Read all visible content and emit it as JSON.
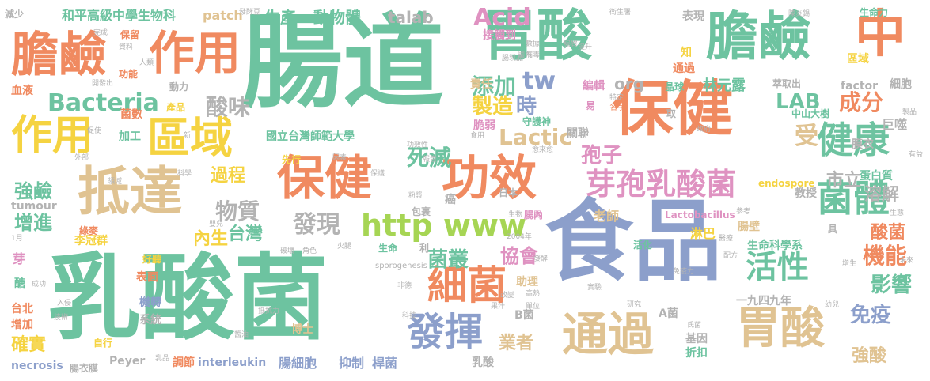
{
  "palette": {
    "green": "#6dc3a0",
    "orange": "#f08a60",
    "blue": "#8c9fcb",
    "pink": "#df92c1",
    "lime": "#a6d554",
    "yellow": "#f5d341",
    "tan": "#e0c392",
    "gray": "#b3b3b3"
  },
  "words": [
    {
      "text": "腸道",
      "size": 128,
      "color": "green"
    },
    {
      "text": "乳酸菌",
      "size": 118,
      "color": "green"
    },
    {
      "text": "食品",
      "size": 112,
      "color": "blue"
    },
    {
      "text": "胃酸",
      "size": 70,
      "color": "green"
    },
    {
      "text": "膽鹼",
      "size": 66,
      "color": "green"
    },
    {
      "text": "保健",
      "size": 76,
      "color": "orange"
    },
    {
      "text": "中",
      "size": 64,
      "color": "orange"
    },
    {
      "text": "膽鹼",
      "size": 60,
      "color": "orange"
    },
    {
      "text": "作用",
      "size": 58,
      "color": "orange"
    },
    {
      "text": "作用",
      "size": 52,
      "color": "yellow"
    },
    {
      "text": "區域",
      "size": 54,
      "color": "yellow"
    },
    {
      "text": "抵達",
      "size": 66,
      "color": "tan"
    },
    {
      "text": "保健",
      "size": 60,
      "color": "orange"
    },
    {
      "text": "功效",
      "size": 60,
      "color": "orange"
    },
    {
      "text": "通過",
      "size": 58,
      "color": "tan"
    },
    {
      "text": "胃酸",
      "size": 56,
      "color": "tan"
    },
    {
      "text": "細菌",
      "size": 50,
      "color": "orange"
    },
    {
      "text": "發揮",
      "size": 48,
      "color": "blue"
    },
    {
      "text": "健康",
      "size": 46,
      "color": "green"
    },
    {
      "text": "菌體",
      "size": 46,
      "color": "green"
    },
    {
      "text": "活性",
      "size": 40,
      "color": "green"
    },
    {
      "text": "芽孢乳酸菌",
      "size": 38,
      "color": "pink"
    },
    {
      "text": "http www",
      "size": 38,
      "color": "lime"
    },
    {
      "text": "Bacteria",
      "size": 30,
      "color": "green"
    },
    {
      "text": "Acid",
      "size": 30,
      "color": "pink"
    },
    {
      "text": "tw",
      "size": 30,
      "color": "blue"
    },
    {
      "text": "Lactic",
      "size": 28,
      "color": "tan"
    },
    {
      "text": "LAB",
      "size": 26,
      "color": "green"
    },
    {
      "text": "成分",
      "size": 28,
      "color": "orange"
    },
    {
      "text": "發現",
      "size": 30,
      "color": "gray"
    },
    {
      "text": "物質",
      "size": 28,
      "color": "gray"
    },
    {
      "text": "酸味",
      "size": 28,
      "color": "gray"
    },
    {
      "text": "添加",
      "size": 28,
      "color": "green"
    },
    {
      "text": "製造",
      "size": 26,
      "color": "yellow"
    },
    {
      "text": "時",
      "size": 26,
      "color": "blue"
    },
    {
      "text": "死滅",
      "size": 28,
      "color": "green"
    },
    {
      "text": "孢子",
      "size": 26,
      "color": "pink"
    },
    {
      "text": "菌叢",
      "size": 26,
      "color": "green"
    },
    {
      "text": "協會",
      "size": 24,
      "color": "pink"
    },
    {
      "text": "機能",
      "size": 28,
      "color": "orange"
    },
    {
      "text": "影響",
      "size": 26,
      "color": "green"
    },
    {
      "text": "免疫",
      "size": 26,
      "color": "blue"
    },
    {
      "text": "強酸",
      "size": 22,
      "color": "tan"
    },
    {
      "text": "業者",
      "size": 22,
      "color": "tan"
    },
    {
      "text": "酸菌",
      "size": 22,
      "color": "orange"
    },
    {
      "text": "受",
      "size": 30,
      "color": "tan"
    },
    {
      "text": "溶解",
      "size": 22,
      "color": "gray"
    },
    {
      "text": "市立",
      "size": 22,
      "color": "gray"
    },
    {
      "text": "強鹼",
      "size": 24,
      "color": "green"
    },
    {
      "text": "過程",
      "size": 22,
      "color": "yellow"
    },
    {
      "text": "增進",
      "size": 24,
      "color": "green"
    },
    {
      "text": "台灣",
      "size": 22,
      "color": "green"
    },
    {
      "text": "內生",
      "size": 22,
      "color": "yellow"
    },
    {
      "text": "確實",
      "size": 22,
      "color": "yellow"
    },
    {
      "text": "生產",
      "size": 20,
      "color": "green"
    },
    {
      "text": "動物體",
      "size": 20,
      "color": "green"
    },
    {
      "text": "talab",
      "size": 20,
      "color": "gray"
    },
    {
      "text": "org",
      "size": 20,
      "color": "gray"
    },
    {
      "text": "林元露",
      "size": 18,
      "color": "green"
    },
    {
      "text": "國立台灣師範大學",
      "size": 14,
      "color": "green"
    },
    {
      "text": "生命科學系",
      "size": 14,
      "color": "green"
    },
    {
      "text": "和平高級中學生物科",
      "size": 16,
      "color": "green"
    },
    {
      "text": "patch",
      "size": 16,
      "color": "tan"
    },
    {
      "text": "李冠群",
      "size": 14,
      "color": "yellow"
    },
    {
      "text": "老師",
      "size": 16,
      "color": "tan"
    },
    {
      "text": "教授",
      "size": 14,
      "color": "gray"
    },
    {
      "text": "助理",
      "size": 14,
      "color": "tan"
    },
    {
      "text": "博士",
      "size": 14,
      "color": "tan"
    },
    {
      "text": "淋巴",
      "size": 16,
      "color": "yellow"
    },
    {
      "text": "腸壁",
      "size": 14,
      "color": "tan"
    },
    {
      "text": "蛋白質",
      "size": 14,
      "color": "green"
    },
    {
      "text": "巨噬",
      "size": 16,
      "color": "gray"
    },
    {
      "text": "膜衣",
      "size": 14,
      "color": "gray"
    },
    {
      "text": "細胞",
      "size": 14,
      "color": "gray"
    },
    {
      "text": "factor",
      "size": 14,
      "color": "gray"
    },
    {
      "text": "endospore",
      "size": 12,
      "color": "yellow"
    },
    {
      "text": "Lactobacillus",
      "size": 12,
      "color": "pink"
    },
    {
      "text": "interleukin",
      "size": 14,
      "color": "blue"
    },
    {
      "text": "necrosis",
      "size": 14,
      "color": "blue"
    },
    {
      "text": "tumour",
      "size": 14,
      "color": "gray"
    },
    {
      "text": "Peyer",
      "size": 14,
      "color": "gray"
    },
    {
      "text": "腸細胞",
      "size": 16,
      "color": "blue"
    },
    {
      "text": "抑制",
      "size": 16,
      "color": "blue"
    },
    {
      "text": "桿菌",
      "size": 16,
      "color": "blue"
    },
    {
      "text": "乳酸",
      "size": 14,
      "color": "gray"
    },
    {
      "text": "折扣",
      "size": 14,
      "color": "green"
    },
    {
      "text": "基因",
      "size": 14,
      "color": "gray"
    },
    {
      "text": "A菌",
      "size": 14,
      "color": "gray"
    },
    {
      "text": "B菌",
      "size": 14,
      "color": "gray"
    },
    {
      "text": "一九四九年",
      "size": 14,
      "color": "gray"
    },
    {
      "text": "生命力",
      "size": 12,
      "color": "green"
    },
    {
      "text": "區域",
      "size": 14,
      "color": "yellow"
    },
    {
      "text": "通過",
      "size": 14,
      "color": "orange"
    },
    {
      "text": "萃取出",
      "size": 12,
      "color": "gray"
    },
    {
      "text": "晶球",
      "size": 12,
      "color": "green"
    },
    {
      "text": "中山大樹",
      "size": 12,
      "color": "green"
    },
    {
      "text": "守護神",
      "size": 12,
      "color": "green"
    },
    {
      "text": "責任",
      "size": 14,
      "color": "tan"
    },
    {
      "text": "接觸到",
      "size": 14,
      "color": "pink"
    },
    {
      "text": "編輯",
      "size": 14,
      "color": "pink"
    },
    {
      "text": "脆弱",
      "size": 14,
      "color": "pink"
    },
    {
      "text": "關聯",
      "size": 14,
      "color": "gray"
    },
    {
      "text": "知",
      "size": 14,
      "color": "yellow"
    },
    {
      "text": "表現",
      "size": 14,
      "color": "gray"
    },
    {
      "text": "動力",
      "size": 12,
      "color": "gray"
    },
    {
      "text": "功能",
      "size": 12,
      "color": "orange"
    },
    {
      "text": "保留",
      "size": 12,
      "color": "orange"
    },
    {
      "text": "血液",
      "size": 14,
      "color": "orange"
    },
    {
      "text": "減少",
      "size": 12,
      "color": "gray"
    },
    {
      "text": "菌數",
      "size": 14,
      "color": "orange"
    },
    {
      "text": "加工",
      "size": 14,
      "color": "green"
    },
    {
      "text": "產品",
      "size": 12,
      "color": "yellow"
    },
    {
      "text": "先行",
      "size": 12,
      "color": "yellow"
    },
    {
      "text": "綠麥",
      "size": 12,
      "color": "orange"
    },
    {
      "text": "好聽",
      "size": 12,
      "color": "yellow"
    },
    {
      "text": "表面",
      "size": 14,
      "color": "orange"
    },
    {
      "text": "機轉",
      "size": 14,
      "color": "blue"
    },
    {
      "text": "系統",
      "size": 14,
      "color": "gray"
    },
    {
      "text": "台北",
      "size": 14,
      "color": "orange"
    },
    {
      "text": "增加",
      "size": 14,
      "color": "orange"
    },
    {
      "text": "調節",
      "size": 14,
      "color": "orange"
    },
    {
      "text": "腸衣膜",
      "size": 12,
      "color": "gray"
    },
    {
      "text": "自行",
      "size": 12,
      "color": "yellow"
    },
    {
      "text": "芽",
      "size": 16,
      "color": "pink"
    },
    {
      "text": "醣",
      "size": 14,
      "color": "green"
    },
    {
      "text": "生命",
      "size": 12,
      "color": "green"
    },
    {
      "text": "活化",
      "size": 12,
      "color": "green"
    },
    {
      "text": "腸內",
      "size": 12,
      "color": "pink"
    },
    {
      "text": "包裹",
      "size": 12,
      "color": "gray"
    },
    {
      "text": "日本",
      "size": 12,
      "color": "gray"
    },
    {
      "text": "癌",
      "size": 14,
      "color": "gray"
    },
    {
      "text": "具",
      "size": 12,
      "color": "gray"
    },
    {
      "text": "取",
      "size": 12,
      "color": "gray"
    },
    {
      "text": "易",
      "size": 12,
      "color": "pink"
    },
    {
      "text": "利",
      "size": 12,
      "color": "gray"
    },
    {
      "text": "sporogenesis",
      "size": 10,
      "color": "gray"
    },
    {
      "text": "2004年",
      "size": 9,
      "color": "gray"
    },
    {
      "text": "名字",
      "size": 10,
      "color": "orange"
    },
    {
      "text": "特定",
      "size": 9,
      "color": "gray"
    },
    {
      "text": "高熱",
      "size": 9,
      "color": "gray"
    },
    {
      "text": "實驗",
      "size": 9,
      "color": "gray"
    },
    {
      "text": "研究",
      "size": 9,
      "color": "gray"
    },
    {
      "text": "發酵豆",
      "size": 9,
      "color": "gray"
    },
    {
      "text": "衛生署",
      "size": 9,
      "color": "gray"
    },
    {
      "text": "陳炎錫",
      "size": 9,
      "color": "gray"
    },
    {
      "text": "腸胃",
      "size": 9,
      "color": "gray"
    },
    {
      "text": "數據",
      "size": 9,
      "color": "gray"
    },
    {
      "text": "病毒",
      "size": 9,
      "color": "gray"
    },
    {
      "text": "人類",
      "size": 9,
      "color": "gray"
    },
    {
      "text": "資料",
      "size": 9,
      "color": "gray"
    },
    {
      "text": "完成",
      "size": 9,
      "color": "gray"
    },
    {
      "text": "開發出",
      "size": 9,
      "color": "gray"
    },
    {
      "text": "科學",
      "size": 9,
      "color": "gray"
    },
    {
      "text": "因素",
      "size": 9,
      "color": "gray"
    },
    {
      "text": "功效性",
      "size": 9,
      "color": "gray"
    },
    {
      "text": "粉漿",
      "size": 9,
      "color": "gray"
    },
    {
      "text": "愈來愈",
      "size": 9,
      "color": "gray"
    },
    {
      "text": "食用",
      "size": 9,
      "color": "gray"
    },
    {
      "text": "報告",
      "size": 9,
      "color": "gray"
    },
    {
      "text": "提升",
      "size": 9,
      "color": "gray"
    },
    {
      "text": "腸製品",
      "size": 9,
      "color": "gray"
    },
    {
      "text": "國內",
      "size": 9,
      "color": "gray"
    },
    {
      "text": "政府",
      "size": 9,
      "color": "gray"
    },
    {
      "text": "有益",
      "size": 9,
      "color": "gray"
    },
    {
      "text": "製品",
      "size": 9,
      "color": "gray"
    },
    {
      "text": "增生",
      "size": 9,
      "color": "gray"
    },
    {
      "text": "幼兒",
      "size": 9,
      "color": "gray"
    },
    {
      "text": "醫療",
      "size": 9,
      "color": "gray"
    },
    {
      "text": "配方",
      "size": 9,
      "color": "gray"
    },
    {
      "text": "氏菌",
      "size": 9,
      "color": "gray"
    },
    {
      "text": "免疫力",
      "size": 9,
      "color": "gray"
    },
    {
      "text": "果汁",
      "size": 9,
      "color": "gray"
    },
    {
      "text": "乳品",
      "size": 9,
      "color": "gray"
    },
    {
      "text": "醬油",
      "size": 9,
      "color": "gray"
    },
    {
      "text": "抵抗力",
      "size": 9,
      "color": "gray"
    },
    {
      "text": "破壞",
      "size": 9,
      "color": "gray"
    },
    {
      "text": "角色",
      "size": 9,
      "color": "gray"
    },
    {
      "text": "火腿",
      "size": 9,
      "color": "gray"
    },
    {
      "text": "成功",
      "size": 9,
      "color": "gray"
    },
    {
      "text": "入侵",
      "size": 9,
      "color": "gray"
    },
    {
      "text": "技術",
      "size": 9,
      "color": "gray"
    },
    {
      "text": "科技",
      "size": 9,
      "color": "gray"
    },
    {
      "text": "非德",
      "size": 9,
      "color": "gray"
    },
    {
      "text": "單位",
      "size": 9,
      "color": "gray"
    },
    {
      "text": "改變",
      "size": 9,
      "color": "gray"
    },
    {
      "text": "促使",
      "size": 9,
      "color": "gray"
    },
    {
      "text": "外部",
      "size": 9,
      "color": "gray"
    },
    {
      "text": "新",
      "size": 9,
      "color": "gray"
    },
    {
      "text": "嬰兒",
      "size": 9,
      "color": "gray"
    },
    {
      "text": "1月",
      "size": 9,
      "color": "gray"
    },
    {
      "text": "領域",
      "size": 9,
      "color": "gray"
    },
    {
      "text": "保護",
      "size": 9,
      "color": "gray"
    },
    {
      "text": "發酵",
      "size": 9,
      "color": "gray"
    },
    {
      "text": "腸",
      "size": 10,
      "color": "pink"
    },
    {
      "text": "生物",
      "size": 9,
      "color": "gray"
    },
    {
      "text": "參考",
      "size": 9,
      "color": "gray"
    },
    {
      "text": "未來",
      "size": 9,
      "color": "gray"
    },
    {
      "text": "生態",
      "size": 9,
      "color": "gray"
    },
    {
      "text": "孢乳",
      "size": 9,
      "color": "gray"
    }
  ]
}
